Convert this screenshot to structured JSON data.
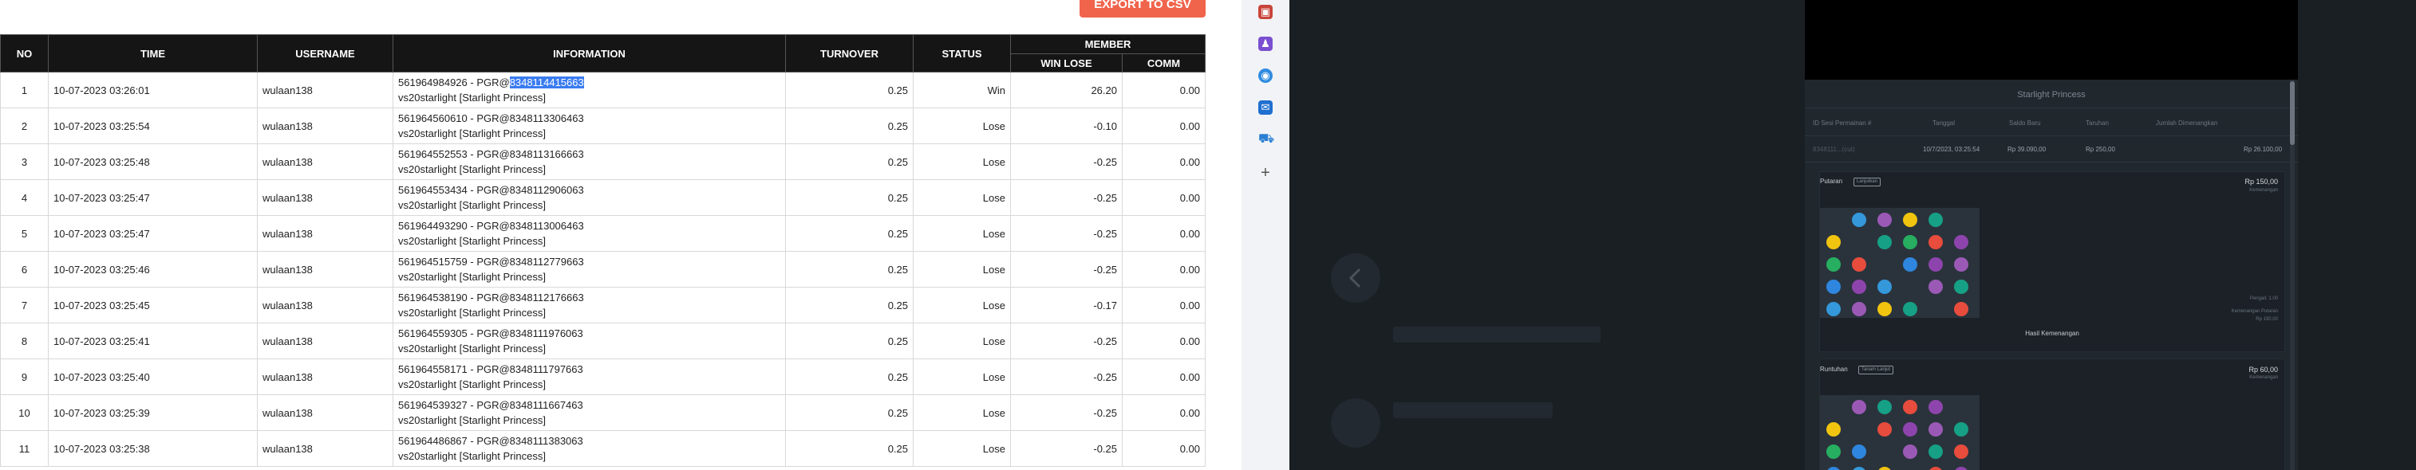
{
  "toolbar": {
    "export_label": "EXPORT TO CSV"
  },
  "table": {
    "headers": {
      "no": "NO",
      "time": "TIME",
      "username": "USERNAME",
      "information": "INFORMATION",
      "turnover": "TURNOVER",
      "status": "STATUS",
      "member": "MEMBER",
      "win_lose": "WIN LOSE",
      "comm": "COMM"
    },
    "rows": [
      {
        "no": "1",
        "time": "10-07-2023 03:26:01",
        "username": "wulaan138",
        "info_prefix": "561964984926 - PGR@",
        "info_highlight": "8348114415663",
        "info_line2": "vs20starlight [Starlight Princess]",
        "turnover": "0.25",
        "status": "Win",
        "win_lose": "26.20",
        "comm": "0.00"
      },
      {
        "no": "2",
        "time": "10-07-2023 03:25:54",
        "username": "wulaan138",
        "info_prefix": "561964560610 - PGR@8348113306463",
        "info_highlight": "",
        "info_line2": "vs20starlight [Starlight Princess]",
        "turnover": "0.25",
        "status": "Lose",
        "win_lose": "-0.10",
        "comm": "0.00"
      },
      {
        "no": "3",
        "time": "10-07-2023 03:25:48",
        "username": "wulaan138",
        "info_prefix": "561964552553 - PGR@8348113166663",
        "info_highlight": "",
        "info_line2": "vs20starlight [Starlight Princess]",
        "turnover": "0.25",
        "status": "Lose",
        "win_lose": "-0.25",
        "comm": "0.00"
      },
      {
        "no": "4",
        "time": "10-07-2023 03:25:47",
        "username": "wulaan138",
        "info_prefix": "561964553434 - PGR@8348112906063",
        "info_highlight": "",
        "info_line2": "vs20starlight [Starlight Princess]",
        "turnover": "0.25",
        "status": "Lose",
        "win_lose": "-0.25",
        "comm": "0.00"
      },
      {
        "no": "5",
        "time": "10-07-2023 03:25:47",
        "username": "wulaan138",
        "info_prefix": "561964493290 - PGR@8348113006463",
        "info_highlight": "",
        "info_line2": "vs20starlight [Starlight Princess]",
        "turnover": "0.25",
        "status": "Lose",
        "win_lose": "-0.25",
        "comm": "0.00"
      },
      {
        "no": "6",
        "time": "10-07-2023 03:25:46",
        "username": "wulaan138",
        "info_prefix": "561964515759 - PGR@8348112779663",
        "info_highlight": "",
        "info_line2": "vs20starlight [Starlight Princess]",
        "turnover": "0.25",
        "status": "Lose",
        "win_lose": "-0.25",
        "comm": "0.00"
      },
      {
        "no": "7",
        "time": "10-07-2023 03:25:45",
        "username": "wulaan138",
        "info_prefix": "561964538190 - PGR@8348112176663",
        "info_highlight": "",
        "info_line2": "vs20starlight [Starlight Princess]",
        "turnover": "0.25",
        "status": "Lose",
        "win_lose": "-0.17",
        "comm": "0.00"
      },
      {
        "no": "8",
        "time": "10-07-2023 03:25:41",
        "username": "wulaan138",
        "info_prefix": "561964559305 - PGR@8348111976063",
        "info_highlight": "",
        "info_line2": "vs20starlight [Starlight Princess]",
        "turnover": "0.25",
        "status": "Lose",
        "win_lose": "-0.25",
        "comm": "0.00"
      },
      {
        "no": "9",
        "time": "10-07-2023 03:25:40",
        "username": "wulaan138",
        "info_prefix": "561964558171 - PGR@8348111797663",
        "info_highlight": "",
        "info_line2": "vs20starlight [Starlight Princess]",
        "turnover": "0.25",
        "status": "Lose",
        "win_lose": "-0.25",
        "comm": "0.00"
      },
      {
        "no": "10",
        "time": "10-07-2023 03:25:39",
        "username": "wulaan138",
        "info_prefix": "561964539327 - PGR@8348111667463",
        "info_highlight": "",
        "info_line2": "vs20starlight [Starlight Princess]",
        "turnover": "0.25",
        "status": "Lose",
        "win_lose": "-0.25",
        "comm": "0.00"
      },
      {
        "no": "11",
        "time": "10-07-2023 03:25:38",
        "username": "wulaan138",
        "info_prefix": "561964486867 - PGR@8348111383063",
        "info_highlight": "",
        "info_line2": "vs20starlight [Starlight Princess]",
        "turnover": "0.25",
        "status": "Lose",
        "win_lose": "-0.25",
        "comm": "0.00"
      }
    ]
  },
  "sidebar_icons": [
    "briefcase-icon",
    "person-icon",
    "copilot-icon",
    "outlook-icon",
    "shopping-icon",
    "add-icon"
  ],
  "game_modal": {
    "title": "Starlight Princess",
    "headers": [
      "ID Sesi Permainan #",
      "Tanggal",
      "Saldo Baru",
      "Taruhan",
      "Jumlah Dimenangkan"
    ],
    "row": {
      "session_id": "8348111...(cut)",
      "date": "10/7/2023, 03:25:54",
      "balance": "Rp 39.090,00",
      "bet": "Rp 250,00",
      "win": "Rp 26.100,00"
    },
    "spin1": {
      "label": "Putaran",
      "tag": "Lanjutkan",
      "prize": "Rp 150,00",
      "prize_sub": "Kemenangan",
      "side_1": "Pengali: 1.00",
      "side_2": "Kemenangan Putaran",
      "side_3": "Rp 150,00",
      "footer": "Hasil Kemenangan"
    },
    "spin2": {
      "label": "Runtuhan",
      "tag": "Tanam Lanjut",
      "prize": "Rp 60,00",
      "prize_sub": "Kemenangan"
    }
  },
  "colors": {
    "header_bg": "#151515",
    "win": "#2e8b2e",
    "lose": "#e23b3b",
    "export": "#f0644c",
    "highlight": "#3a7cf0"
  }
}
